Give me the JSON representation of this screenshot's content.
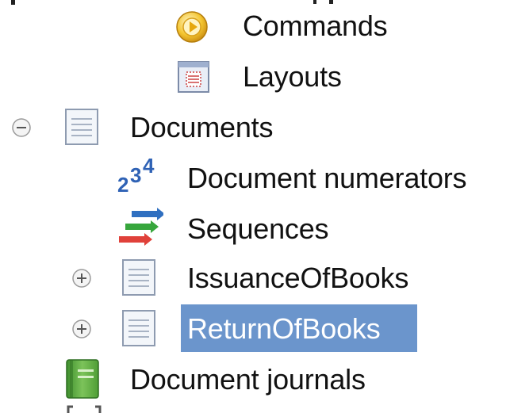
{
  "tree": {
    "items": [
      {
        "label": "Commands",
        "icon": "commands-icon",
        "expander": null,
        "selected": false
      },
      {
        "label": "Layouts",
        "icon": "layout-icon",
        "expander": null,
        "selected": false
      },
      {
        "label": "Documents",
        "icon": "document-icon",
        "expander": "collapse",
        "selected": false
      },
      {
        "label": "Document numerators",
        "icon": "numerator-icon",
        "expander": null,
        "selected": false
      },
      {
        "label": "Sequences",
        "icon": "sequence-icon",
        "expander": null,
        "selected": false
      },
      {
        "label": "IssuanceOfBooks",
        "icon": "document-icon",
        "expander": "expand",
        "selected": false
      },
      {
        "label": "ReturnOfBooks",
        "icon": "document-icon",
        "expander": "expand",
        "selected": true
      },
      {
        "label": "Document journals",
        "icon": "journal-icon",
        "expander": null,
        "selected": false
      }
    ],
    "selection_color": "#6b95cc"
  }
}
